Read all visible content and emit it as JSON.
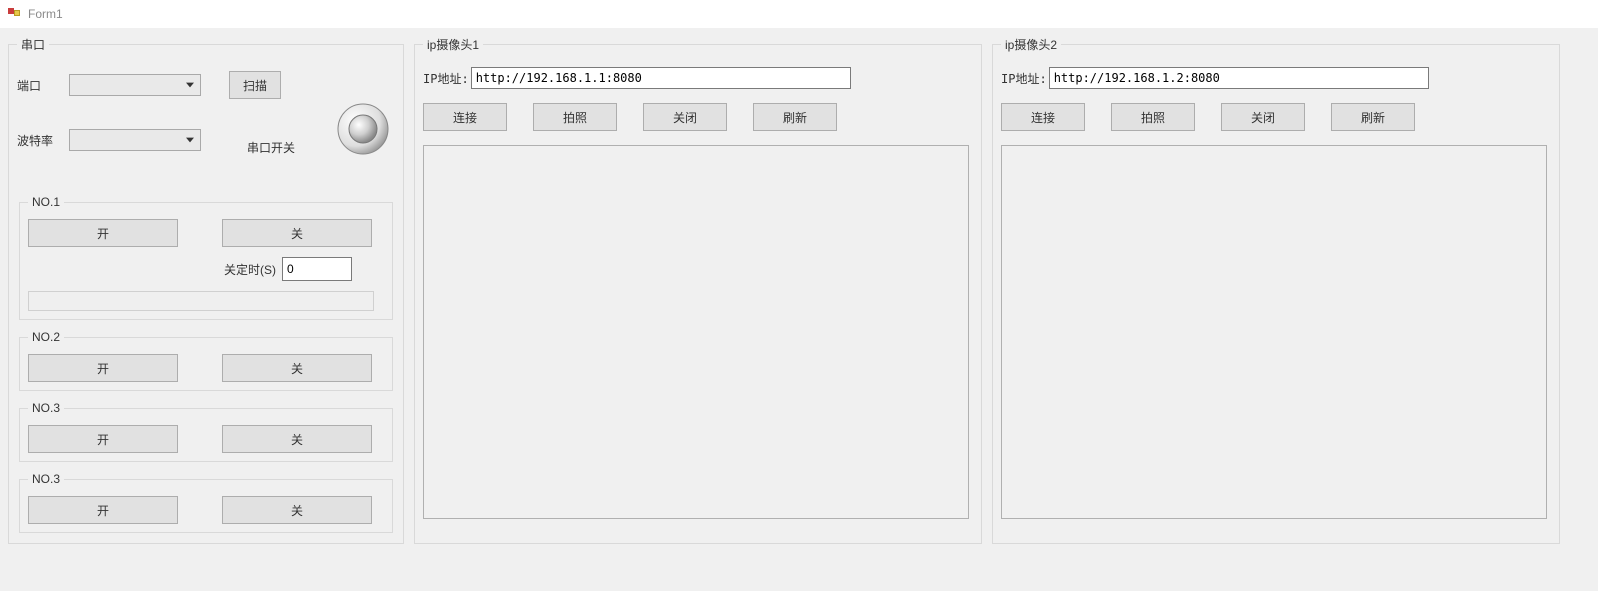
{
  "window": {
    "title": "Form1"
  },
  "serial": {
    "group_title": "串口",
    "port_label": "端口",
    "port_value": "",
    "baud_label": "波特率",
    "baud_value": "",
    "scan_label": "扫描",
    "switch_label": "串口开关",
    "channels": [
      {
        "title": "NO.1",
        "open_label": "开",
        "close_label": "关",
        "timer_label": "关定时(S)",
        "timer_value": "0",
        "status_text": ""
      },
      {
        "title": "NO.2",
        "open_label": "开",
        "close_label": "关"
      },
      {
        "title": "NO.3",
        "open_label": "开",
        "close_label": "关"
      },
      {
        "title": "NO.3",
        "open_label": "开",
        "close_label": "关"
      }
    ]
  },
  "cameras": [
    {
      "group_title": "ip摄像头1",
      "ip_label": "IP地址:",
      "ip_value": "http://192.168.1.1:8080",
      "btn_connect": "连接",
      "btn_capture": "拍照",
      "btn_close": "关闭",
      "btn_refresh": "刷新"
    },
    {
      "group_title": "ip摄像头2",
      "ip_label": "IP地址:",
      "ip_value": "http://192.168.1.2:8080",
      "btn_connect": "连接",
      "btn_capture": "拍照",
      "btn_close": "关闭",
      "btn_refresh": "刷新"
    }
  ]
}
